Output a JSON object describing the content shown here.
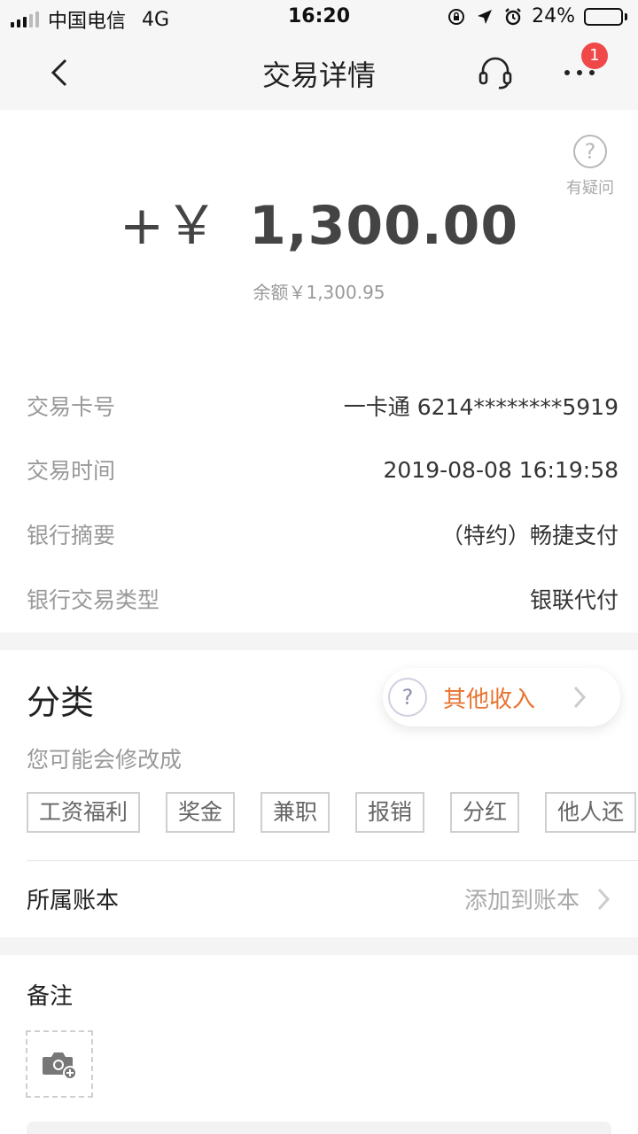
{
  "status_bar": {
    "carrier": "中国电信",
    "network": "4G",
    "time": "16:20",
    "battery": "24%",
    "battery_level": 0.24
  },
  "nav": {
    "title": "交易详情",
    "badge_count": "1"
  },
  "summary": {
    "help_label": "有疑问",
    "amount_sign": "+￥",
    "amount": "1,300.00",
    "balance": "余额￥1,300.95"
  },
  "details": [
    {
      "label": "交易卡号",
      "value": "一卡通 6214********5919"
    },
    {
      "label": "交易时间",
      "value": "2019-08-08 16:19:58"
    },
    {
      "label": "银行摘要",
      "value": "（特约）畅捷支付"
    },
    {
      "label": "银行交易类型",
      "value": "银联代付"
    }
  ],
  "category": {
    "title": "分类",
    "current": "其他收入",
    "suggest_label": "您可能会修改成",
    "tags": [
      "工资福利",
      "奖金",
      "兼职",
      "报销",
      "分红",
      "他人还"
    ]
  },
  "account_book": {
    "label": "所属账本",
    "action": "添加到账本"
  },
  "note": {
    "title": "备注"
  },
  "colors": {
    "accent": "#e8732f",
    "badge": "#f04848"
  }
}
